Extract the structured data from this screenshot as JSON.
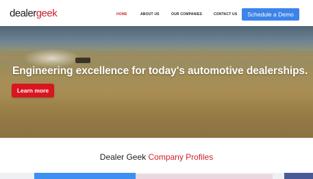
{
  "logo": {
    "dealer": "dealer",
    "geek": "geek"
  },
  "nav": {
    "home": "HOME",
    "about": "ABOUT US",
    "companies": "OUR COMPANIES",
    "contact": "CONTACT US",
    "active": "home"
  },
  "cta": {
    "label": "Schedule a Demo"
  },
  "hero": {
    "title": "Engineering excellence for today's automotive dealerships.",
    "button": "Learn more"
  },
  "section": {
    "title_dark": "Dealer Geek ",
    "title_red": "Company Profiles"
  },
  "colors": {
    "brand_red": "#d0202c",
    "cta_blue": "#3d83ea",
    "button_red": "#d8161f"
  }
}
